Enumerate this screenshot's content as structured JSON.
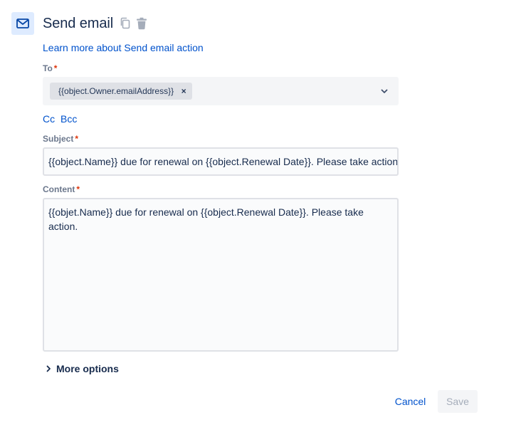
{
  "header": {
    "title": "Send email",
    "icon": "mail-icon",
    "copy_icon": "copy-icon",
    "delete_icon": "trash-icon"
  },
  "learn_more_link": "Learn more about Send email action",
  "to": {
    "label": "To",
    "required_marker": "*",
    "chips": [
      {
        "text": "{{object.Owner.emailAddress}}",
        "remove_glyph": "×"
      }
    ],
    "dropdown_icon": "chevron-down-icon"
  },
  "cc_link": "Cc",
  "bcc_link": "Bcc",
  "subject": {
    "label": "Subject",
    "required_marker": "*",
    "value": "{{object.Name}} due for renewal on {{object.Renewal Date}}. Please take action."
  },
  "content": {
    "label": "Content",
    "required_marker": "*",
    "value": "{{objet.Name}} due for renewal on {{object.Renewal Date}}. Please take action."
  },
  "more_options": {
    "label": "More options",
    "icon": "chevron-right-icon"
  },
  "actions": {
    "cancel_label": "Cancel",
    "save_label": "Save"
  },
  "colors": {
    "link": "#0052cc",
    "required": "#de350b",
    "icon_bg": "#deebff",
    "field_bg": "#f4f5f7",
    "disabled_text": "#a5adba"
  }
}
